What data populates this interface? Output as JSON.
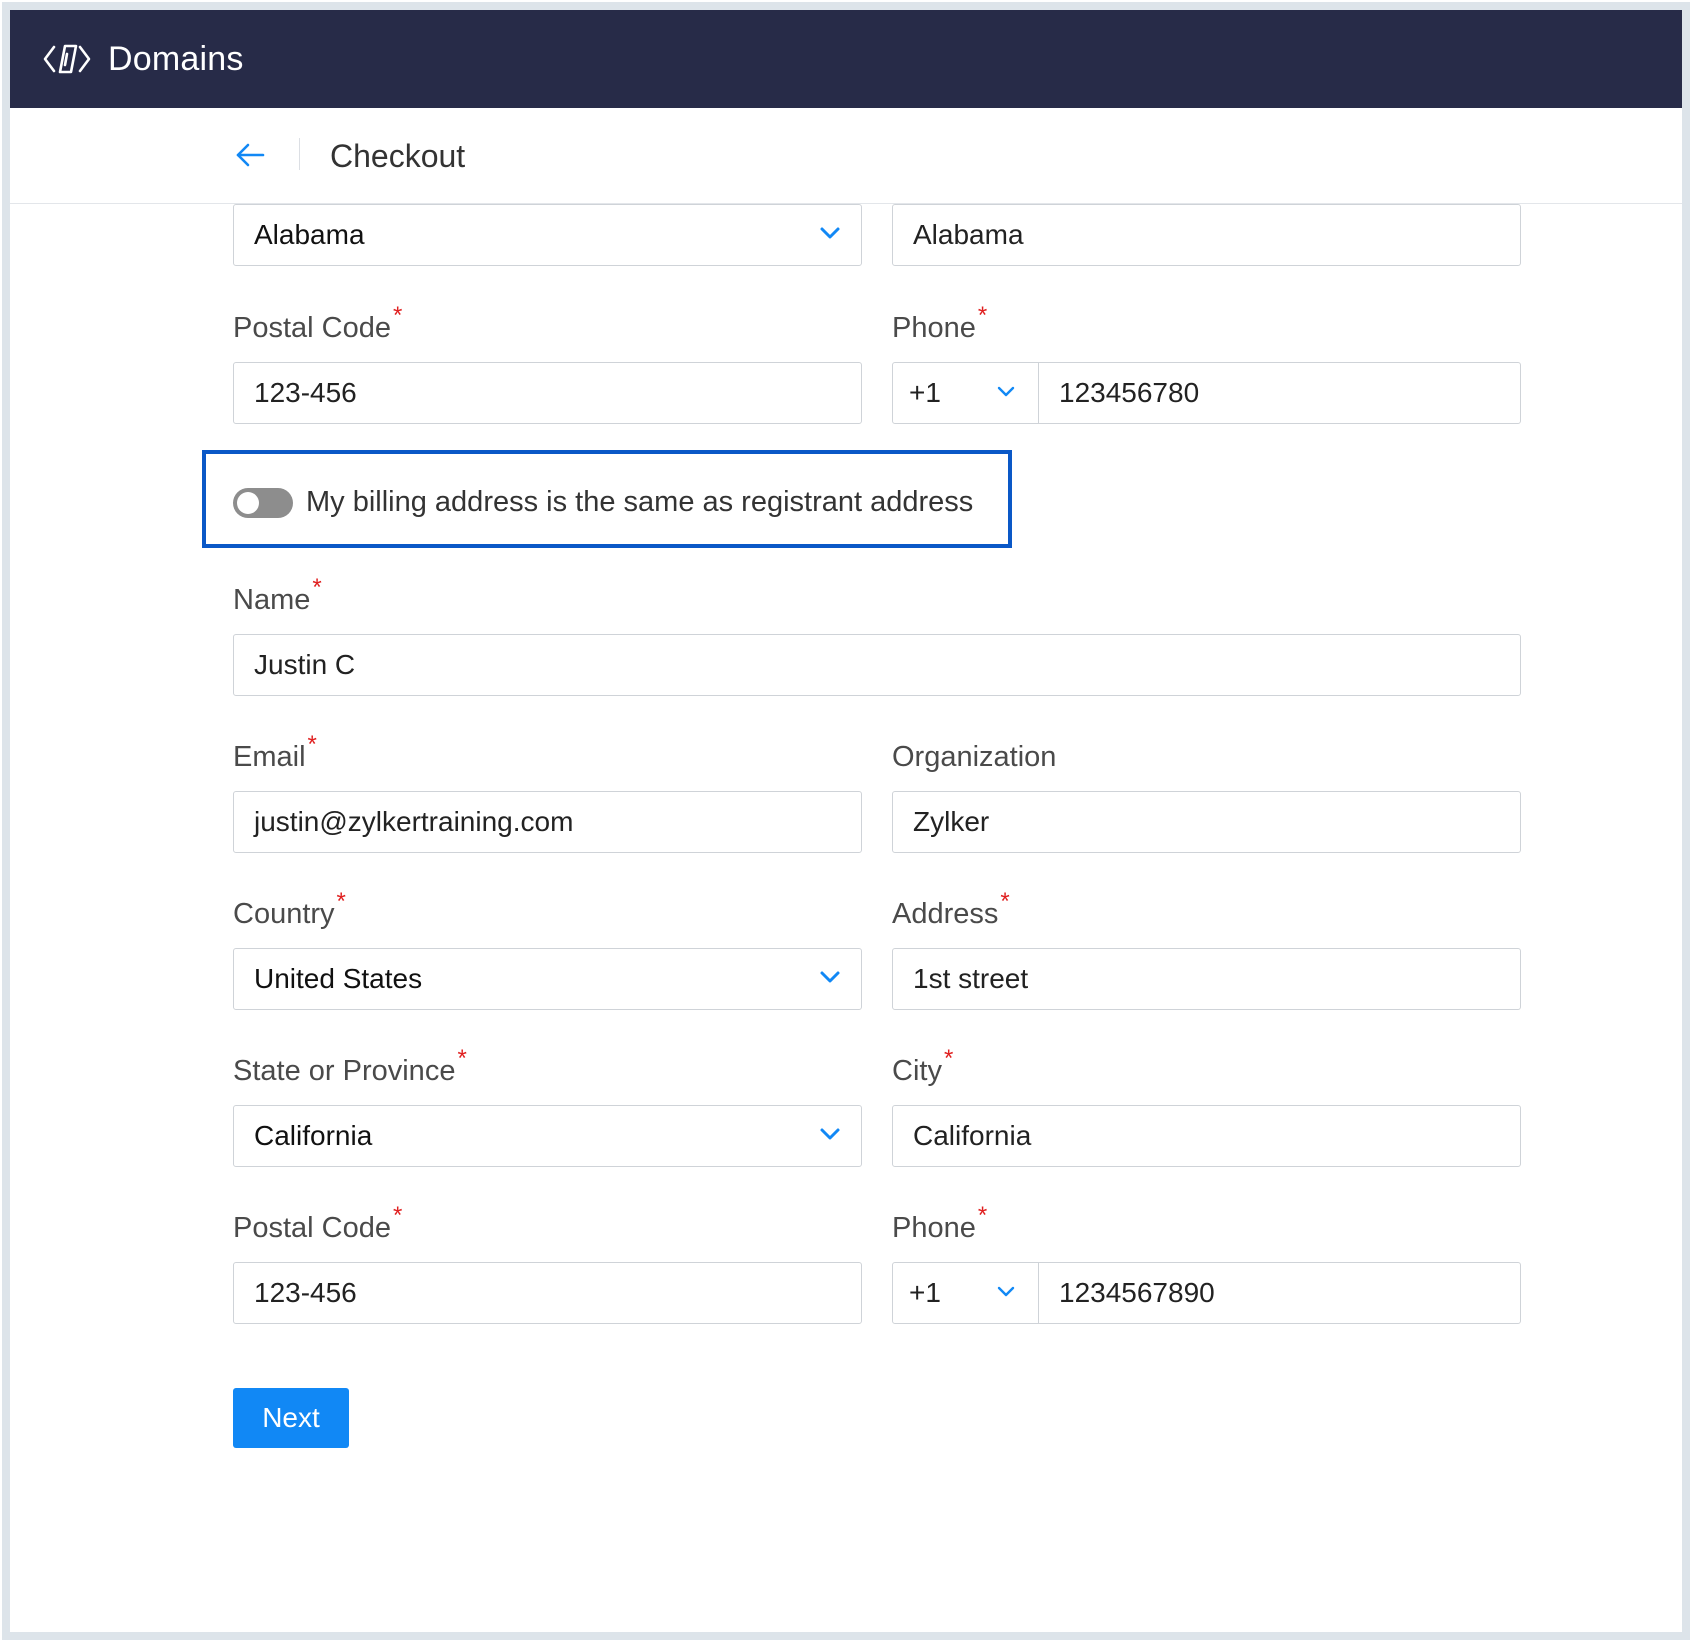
{
  "app": {
    "title": "Domains",
    "logo_icon": "domains-logo-icon"
  },
  "subheader": {
    "back_icon": "arrow-left-icon",
    "title": "Checkout"
  },
  "registrant_partial": {
    "state_select": "Alabama",
    "city": "Alabama",
    "postal_code_label": "Postal Code",
    "postal_code": "123-456",
    "phone_label": "Phone",
    "phone_code": "+1",
    "phone_number": "123456780"
  },
  "billing_toggle": {
    "label": "My billing address is the same as registrant address",
    "checked": false
  },
  "billing": {
    "name_label": "Name",
    "name": "Justin C",
    "email_label": "Email",
    "email": "justin@zylkertraining.com",
    "organization_label": "Organization",
    "organization": "Zylker",
    "country_label": "Country",
    "country": "United States",
    "address_label": "Address",
    "address": "1st street",
    "state_label": "State or Province",
    "state": "California",
    "city_label": "City",
    "city": "California",
    "postal_code_label": "Postal Code",
    "postal_code": "123-456",
    "phone_label": "Phone",
    "phone_code": "+1",
    "phone_number": "1234567890"
  },
  "required_marker": "*",
  "actions": {
    "next_label": "Next"
  },
  "colors": {
    "topbar": "#272b48",
    "accent": "#1188f5",
    "highlight_border": "#0a58c7",
    "required": "#e02020"
  }
}
